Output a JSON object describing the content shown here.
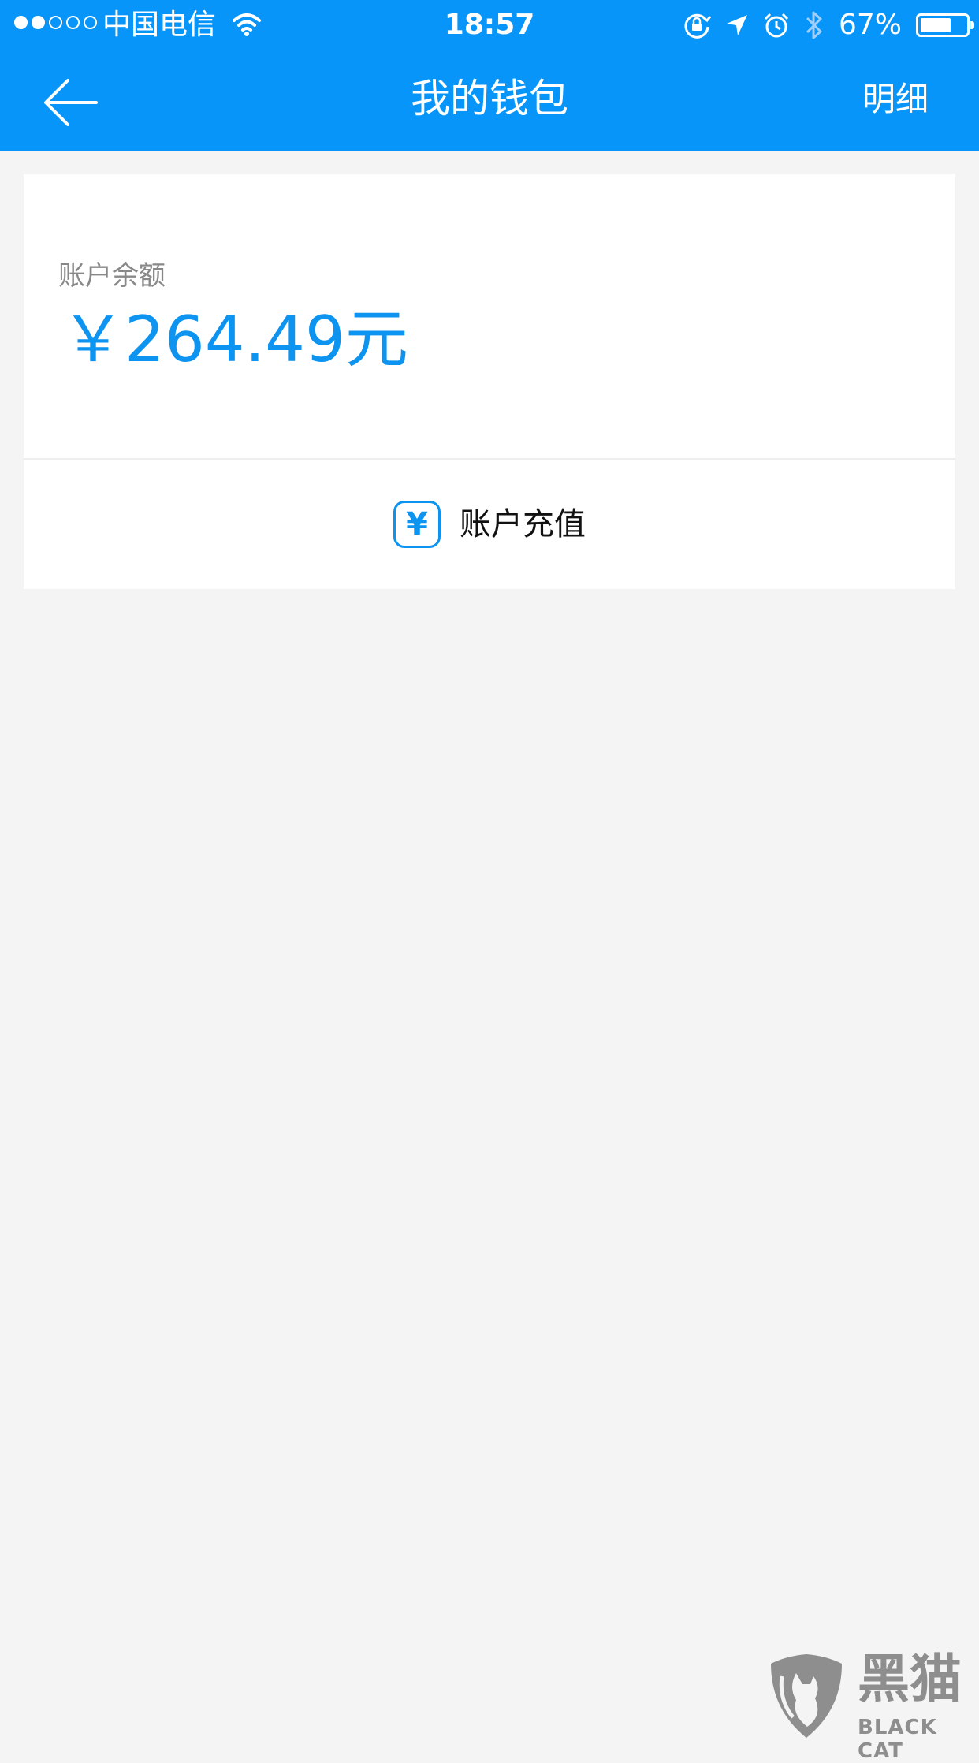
{
  "status_bar": {
    "signal_strength": "2/5",
    "carrier": "中国电信",
    "time": "18:57",
    "icons": [
      "wifi-icon",
      "rotation-lock-icon",
      "location-icon",
      "alarm-icon",
      "bluetooth-icon"
    ],
    "battery_text": "67%",
    "battery_level": 0.67
  },
  "nav": {
    "back_icon": "back-arrow-icon",
    "title": "我的钱包",
    "detail_label": "明细"
  },
  "wallet": {
    "balance_label": "账户余额",
    "balance_amount": "￥264.49元",
    "recharge_icon": "yen-icon",
    "recharge_icon_glyph": "¥",
    "recharge_label": "账户充值"
  },
  "watermark": {
    "name": "黑猫",
    "subtitle": "BLACK CAT"
  },
  "colors": {
    "primary": "#0895f9",
    "accent_text": "#0d93f0",
    "background": "#f4f4f4",
    "card": "#ffffff"
  }
}
